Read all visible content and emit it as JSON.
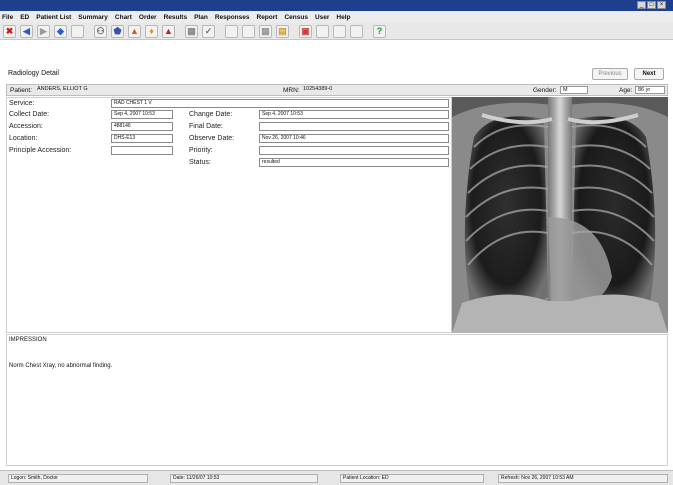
{
  "titlebar": {
    "minimize": "_",
    "maximize": "□",
    "close": "×"
  },
  "menu": [
    "File",
    "ED",
    "Patient List",
    "Summary",
    "Chart",
    "Order",
    "Results",
    "Plan",
    "Responses",
    "Report",
    "Census",
    "User",
    "Help"
  ],
  "toolbar": {
    "buttons": [
      {
        "icon": "close-icon",
        "glyph": "✖",
        "color": "#d01818"
      },
      {
        "icon": "back-arrow-icon",
        "glyph": "◀",
        "color": "#2a5bd7"
      },
      {
        "icon": "forward-arrow-icon",
        "glyph": "▶",
        "color": "#9a9a9a"
      },
      {
        "icon": "home-icon",
        "glyph": "◆",
        "color": "#2a5bd7"
      },
      {
        "icon": "blank-icon",
        "glyph": "",
        "color": "#aaaaaa"
      },
      {
        "icon": "binoculars-icon",
        "glyph": "⚇",
        "color": "#555555"
      },
      {
        "icon": "shield-icon",
        "glyph": "⬟",
        "color": "#3355aa"
      },
      {
        "icon": "warning-icon",
        "glyph": "▲",
        "color": "#d95a10"
      },
      {
        "icon": "bell-icon",
        "glyph": "♦",
        "color": "#c8a030"
      },
      {
        "icon": "alert-icon",
        "glyph": "▲",
        "color": "#c02020"
      },
      {
        "icon": "chart-icon",
        "glyph": "▦",
        "color": "#888888"
      },
      {
        "icon": "check-icon",
        "glyph": "✓",
        "color": "#777777"
      },
      {
        "icon": "blank-icon",
        "glyph": "",
        "color": "#aaaaaa"
      },
      {
        "icon": "blank-icon",
        "glyph": "",
        "color": "#aaaaaa"
      },
      {
        "icon": "grid-icon",
        "glyph": "▦",
        "color": "#999999"
      },
      {
        "icon": "document-icon",
        "glyph": "▤",
        "color": "#d4a020"
      },
      {
        "icon": "image-icon",
        "glyph": "▣",
        "color": "#c04040"
      },
      {
        "icon": "blank-icon",
        "glyph": "",
        "color": "#aaaaaa"
      },
      {
        "icon": "blank-icon",
        "glyph": "",
        "color": "#aaaaaa"
      },
      {
        "icon": "blank-icon",
        "glyph": "",
        "color": "#aaaaaa"
      },
      {
        "icon": "help-icon",
        "glyph": "?",
        "color": "#1c9a1c"
      }
    ]
  },
  "header": {
    "title": "Radiology Detail",
    "previous_label": "Previous",
    "next_label": "Next"
  },
  "patient": {
    "patient_label": "Patient:",
    "patient_value": "ANDERS, ELLIOT G",
    "mrn_label": "MRN:",
    "mrn_value": "10254389-0",
    "gender_label": "Gender:",
    "gender_value": "M",
    "age_label": "Age:",
    "age_value": "86 yr"
  },
  "form": {
    "service_label": "Service:",
    "service_value": "RAD CHEST 1 V",
    "collect_label": "Collect Date:",
    "collect_value": "Sep 4, 2007 10:53",
    "accession_label": "Accession:",
    "accession_value": "488146",
    "location_label": "Location:",
    "location_value": "DHS-E13",
    "principle_label": "Principle Accession:",
    "principle_value": "",
    "change_label": "Change Date:",
    "change_value": "Sep 4, 2007 10:53",
    "final_label": "Final Date:",
    "final_value": "",
    "observe_label": "Observe Date:",
    "observe_value": "Nov 26, 2007 10:46",
    "priority_label": "Priority:",
    "priority_value": "",
    "status_label": "Status:",
    "status_value": "resulted"
  },
  "impression": {
    "heading": "IMPRESSION",
    "text": "Norm Chest Xray, no abnormal finding."
  },
  "status": {
    "segments": [
      "Logon: Smith, Doctor",
      "Date: 11/26/07 10:53",
      "Patient Location: ED",
      "Refresh: Nov 26, 2007 10:53 AM"
    ]
  }
}
